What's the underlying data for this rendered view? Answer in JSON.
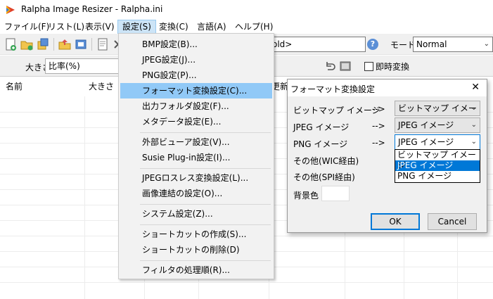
{
  "window": {
    "title": "Ralpha Image Resizer - Ralpha.ini"
  },
  "menubar": {
    "items": [
      "ファイル(F)",
      "リスト(L)",
      "表示(V)",
      "設定(S)",
      "変換(C)",
      "言語(A)",
      "ヘルプ(H)"
    ],
    "active_index": 3
  },
  "toolbar": {
    "path_text": "old>",
    "mode_label": "モード",
    "mode_value": "Normal"
  },
  "toolbar2": {
    "size_label": "大きさ",
    "size_value": "比率(%)",
    "instant_convert_label": "即時変換",
    "instant_convert_checked": false
  },
  "listview": {
    "columns": [
      "名前",
      "大きさ",
      "更新"
    ]
  },
  "settings_menu": {
    "items": [
      "BMP設定(B)...",
      "JPEG設定(J)...",
      "PNG設定(P)...",
      "フォーマット変換設定(C)...",
      "出力フォルダ設定(F)...",
      "メタデータ設定(E)...",
      "外部ビューア設定(V)...",
      "Susie Plug-in設定(I)...",
      "JPEGロスレス変換設定(L)...",
      "画像連結の設定(O)...",
      "システム設定(Z)...",
      "ショートカットの作成(S)...",
      "ショートカットの削除(D)",
      "フィルタの処理順(R)..."
    ],
    "highlighted_index": 3
  },
  "dialog": {
    "title": "フォーマット変換設定",
    "close_glyph": "✕",
    "arrow": "-->",
    "rows": [
      {
        "label": "ビットマップ イメージ",
        "value": "ビットマップ イメージ"
      },
      {
        "label": "JPEG イメージ",
        "value": "JPEG イメージ"
      },
      {
        "label": "PNG イメージ",
        "value": "JPEG イメージ"
      }
    ],
    "other_wic_label": "その他(WIC経由)",
    "other_spi_label": "その他(SPI経由)",
    "bg_color_label": "背景色",
    "open_list_options": [
      "ビットマップ イメージ",
      "JPEG イメージ",
      "PNG イメージ"
    ],
    "open_list_selected_index": 1,
    "ok_label": "OK",
    "cancel_label": "Cancel"
  },
  "colors": {
    "menu_highlight": "#91c9f7",
    "selection_blue": "#0078d7",
    "menu_active": "#cce4f7"
  },
  "icons": {
    "chevron": "⌄"
  }
}
